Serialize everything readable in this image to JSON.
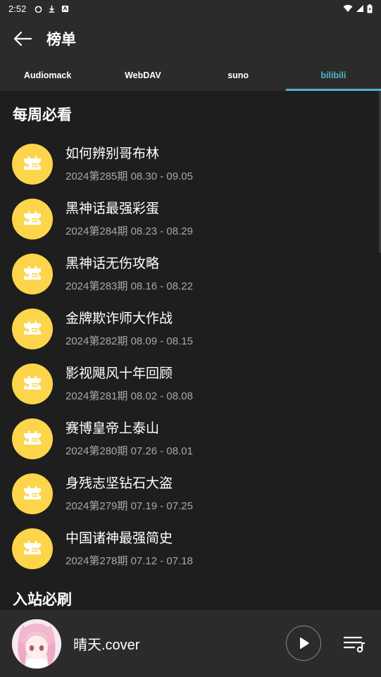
{
  "status_bar": {
    "time": "2:52"
  },
  "app_bar": {
    "title": "榜单"
  },
  "tabs": [
    {
      "label": "Audiomack",
      "active": false
    },
    {
      "label": "WebDAV",
      "active": false
    },
    {
      "label": "suno",
      "active": false
    },
    {
      "label": "bilibili",
      "active": true
    }
  ],
  "sections": [
    {
      "title": "每周必看",
      "items": [
        {
          "title": "如何辨别哥布林",
          "subtitle": "2024第285期 08.30 - 09.05",
          "icon": "ticket-icon"
        },
        {
          "title": "黑神话最强彩蛋",
          "subtitle": "2024第284期 08.23 - 08.29",
          "icon": "ticket-icon"
        },
        {
          "title": "黑神话无伤攻略",
          "subtitle": "2024第283期 08.16 - 08.22",
          "icon": "ticket-icon"
        },
        {
          "title": "金牌欺诈师大作战",
          "subtitle": "2024第282期 08.09 - 08.15",
          "icon": "ticket-icon"
        },
        {
          "title": "影视飓风十年回顾",
          "subtitle": "2024第281期 08.02 - 08.08",
          "icon": "ticket-icon"
        },
        {
          "title": "赛博皇帝上泰山",
          "subtitle": "2024第280期 07.26 - 08.01",
          "icon": "ticket-icon"
        },
        {
          "title": "身残志坚钻石大盗",
          "subtitle": "2024第279期 07.19 - 07.25",
          "icon": "ticket-icon"
        },
        {
          "title": "中国诸神最强简史",
          "subtitle": "2024第278期 07.12 - 07.18",
          "icon": "ticket-icon"
        }
      ]
    },
    {
      "title": "入站必刷"
    }
  ],
  "player": {
    "song_title": "晴天.cover"
  },
  "colors": {
    "accent": "#4cb8c8",
    "icon_bg": "#fdd54b",
    "background": "#1e1e1e",
    "bar": "#2b2b2b"
  }
}
